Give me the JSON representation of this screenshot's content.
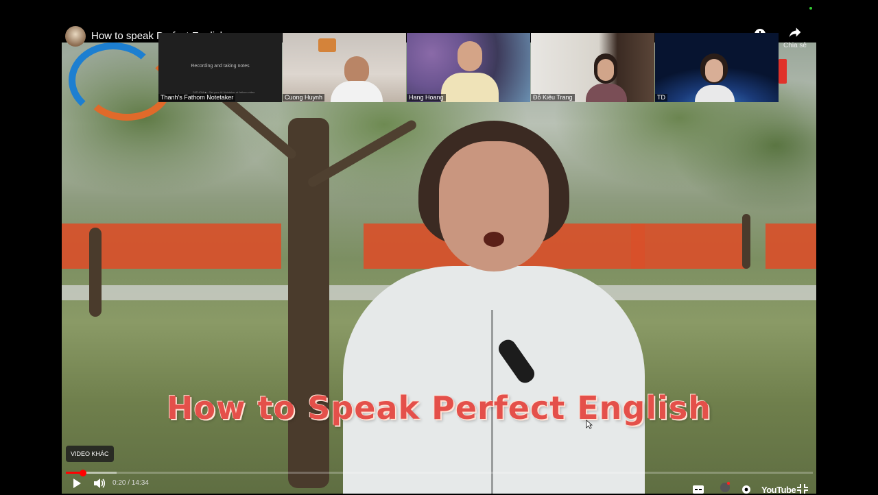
{
  "video": {
    "title": "How to speak Perfect English",
    "headline": "How to Speak Perfect English",
    "more_videos_label": "VIDEO KHÁC",
    "share_label": "Chia sẻ",
    "time_display": "0:20 / 14:34",
    "progress_fraction": 0.023,
    "buffered_fraction": 0.068,
    "logo_text": "YouTube"
  },
  "meeting": {
    "participants": [
      {
        "name": "Thanh's Fathom Notetaker",
        "note": "Recording and taking notes",
        "sub": "FATHOM ■ · Get your AI Notetaker at fathom.video"
      },
      {
        "name": "Cuong Huynh"
      },
      {
        "name": "Hang Hoang"
      },
      {
        "name": "Đỗ Kiều Trang"
      },
      {
        "name": "TD"
      }
    ]
  },
  "icons": {
    "play": "play-icon",
    "volume": "volume-icon",
    "captions": "captions-icon",
    "autoplay": "autoplay-icon",
    "settings": "gear-icon",
    "fullscreen_exit": "exit-fullscreen-icon",
    "watch_later": "clock-icon",
    "share": "share-icon"
  },
  "colors": {
    "progress": "#ff0000",
    "headline": "#e4504a",
    "banner": "#d8502a"
  }
}
